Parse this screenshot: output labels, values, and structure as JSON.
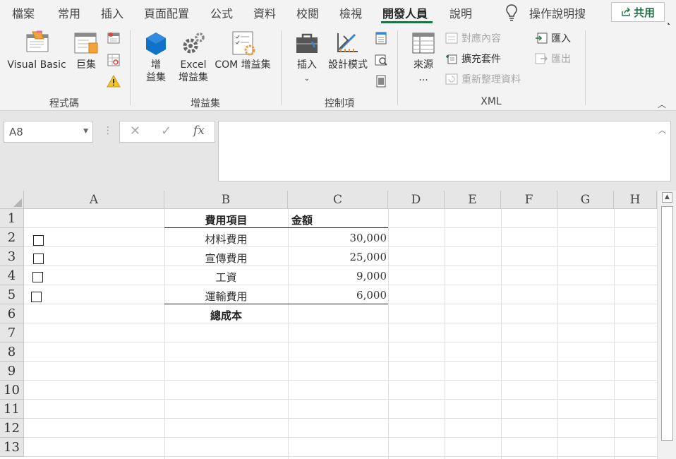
{
  "tabs": [
    "檔案",
    "常用",
    "插入",
    "頁面配置",
    "公式",
    "資料",
    "校閱",
    "檢視",
    "開發人員",
    "說明"
  ],
  "active_tab": "開發人員",
  "help_search": "操作說明搜",
  "share_label": "共用",
  "ribbon": {
    "code_group": {
      "label": "程式碼",
      "visual_basic": "Visual Basic",
      "macros": "巨集"
    },
    "addins_group": {
      "label": "增益集",
      "addins_l1": "增",
      "addins_l2": "益集",
      "excel_addins_l1": "Excel",
      "excel_addins_l2": "增益集",
      "com_addins": "COM 增益集"
    },
    "controls_group": {
      "label": "控制項",
      "insert": "插入",
      "design_mode": "設計模式"
    },
    "xml_group": {
      "label": "XML",
      "source": "來源",
      "source_more": "...",
      "map_properties": "對應內容",
      "expansion_packs": "擴充套件",
      "refresh_data": "重新整理資料",
      "import": "匯入",
      "export": "匯出"
    }
  },
  "formula_bar": {
    "name_box": "A8",
    "cancel_icon": "✕",
    "enter_icon": "✓",
    "fx_label": "fx",
    "formula": ""
  },
  "columns": [
    "A",
    "B",
    "C",
    "D",
    "E",
    "F",
    "G",
    "H"
  ],
  "rows": [
    "1",
    "2",
    "3",
    "4",
    "5",
    "6",
    "7",
    "8",
    "9",
    "10",
    "11",
    "12",
    "13"
  ],
  "table": {
    "header_item": "費用項目",
    "header_amount": "金額",
    "items": [
      {
        "name": "材料費用",
        "amount": "30,000"
      },
      {
        "name": "宣傳費用",
        "amount": "25,000"
      },
      {
        "name": "工資",
        "amount": "9,000"
      },
      {
        "name": "運輸費用",
        "amount": "6,000"
      }
    ],
    "total_label": "總成本"
  },
  "colors": {
    "accent": "#217346",
    "ribbon_bg": "#f3f3f3",
    "header_bg": "#e6e6e6",
    "gridline": "#e1e1e1"
  }
}
